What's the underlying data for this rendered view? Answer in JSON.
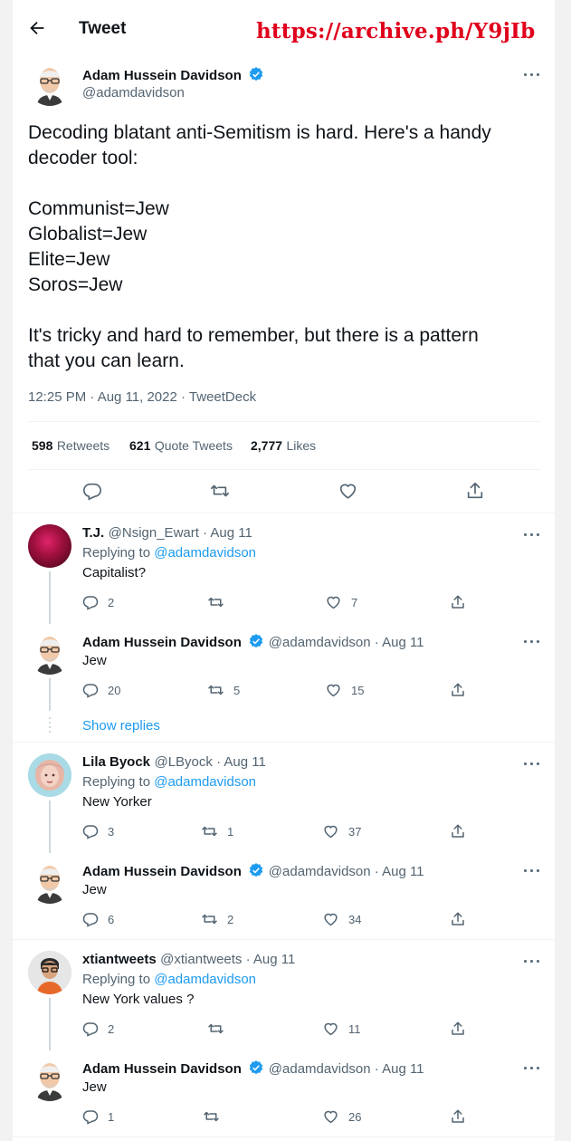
{
  "header": {
    "back_icon": "arrow-left-icon",
    "title": "Tweet",
    "archive_url": "https://archive.ph/Y9jIb"
  },
  "main_tweet": {
    "author_name": "Adam Hussein Davidson",
    "author_handle": "@adamdavidson",
    "lines": [
      "Decoding blatant anti-Semitism is hard. Here's a handy",
      "decoder tool:",
      "",
      "Communist=Jew",
      "Globalist=Jew",
      "Elite=Jew",
      "Soros=Jew",
      "",
      "It's tricky and hard to remember, but there is a pattern",
      "that you can learn."
    ],
    "timestamp": "12:25 PM · Aug 11, 2022 · TweetDeck",
    "stats": [
      {
        "num": "598",
        "label": "Retweets"
      },
      {
        "num": "621",
        "label": "Quote Tweets"
      },
      {
        "num": "2,777",
        "label": "Likes"
      }
    ]
  },
  "replies": [
    {
      "name": "T.J.",
      "meta": "@Nsign_Ewart · Aug 11",
      "replying_prefix": "Replying to ",
      "replying_to": "@adamdavidson",
      "text": "Capitalist?",
      "counts": [
        "2",
        "",
        "7",
        ""
      ]
    },
    {
      "name": "Adam Hussein Davidson",
      "meta": "@adamdavidson · Aug 11",
      "text": "Jew",
      "counts": [
        "20",
        "5",
        "15",
        ""
      ]
    },
    {
      "show_replies": "Show replies"
    },
    {
      "name": "Lila Byock",
      "meta": "@LByock · Aug 11",
      "replying_prefix": "Replying to ",
      "replying_to": "@adamdavidson",
      "text": "New Yorker",
      "counts": [
        "3",
        "1",
        "37",
        ""
      ]
    },
    {
      "name": "Adam Hussein Davidson",
      "meta": "@adamdavidson · Aug 11",
      "text": "Jew",
      "counts": [
        "6",
        "2",
        "34",
        ""
      ]
    },
    {
      "name": "xtiantweets",
      "meta": "@xtiantweets · Aug 11",
      "replying_prefix": "Replying to ",
      "replying_to": "@adamdavidson",
      "text": "New York values ?",
      "counts": [
        "2",
        "",
        "11",
        ""
      ]
    },
    {
      "name": "Adam Hussein Davidson",
      "meta": "@adamdavidson · Aug 11",
      "text": "Jew",
      "counts": [
        "1",
        "",
        "26",
        ""
      ]
    }
  ],
  "colors": {
    "accent": "#1d9bf0",
    "archive_red": "#e0001b",
    "muted": "#536471"
  }
}
